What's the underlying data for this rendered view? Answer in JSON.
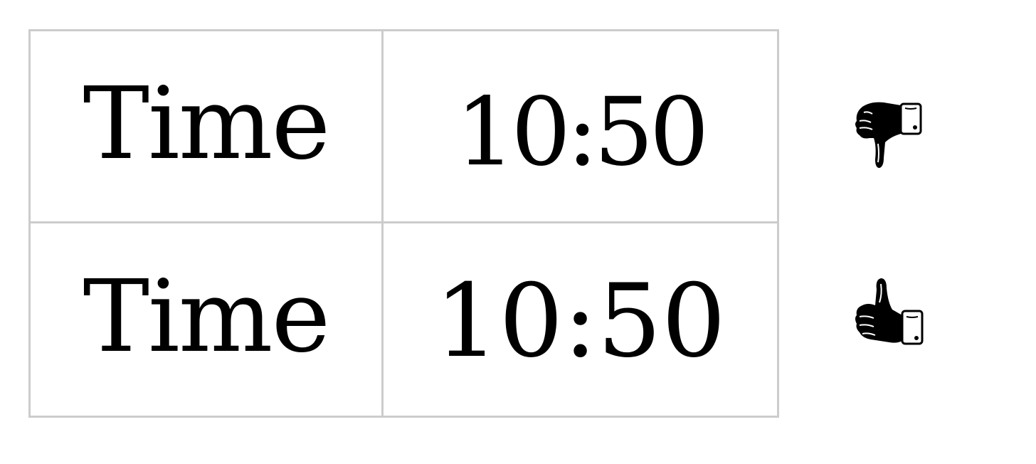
{
  "rows": [
    {
      "label": "Time",
      "value": "10:50",
      "feedback_icon": "thumbs-down-icon"
    },
    {
      "label": "Time",
      "value": "10:50",
      "feedback_icon": "thumbs-up-icon"
    }
  ],
  "colors": {
    "border": "#cccccc",
    "text": "#000000",
    "background": "#ffffff"
  }
}
